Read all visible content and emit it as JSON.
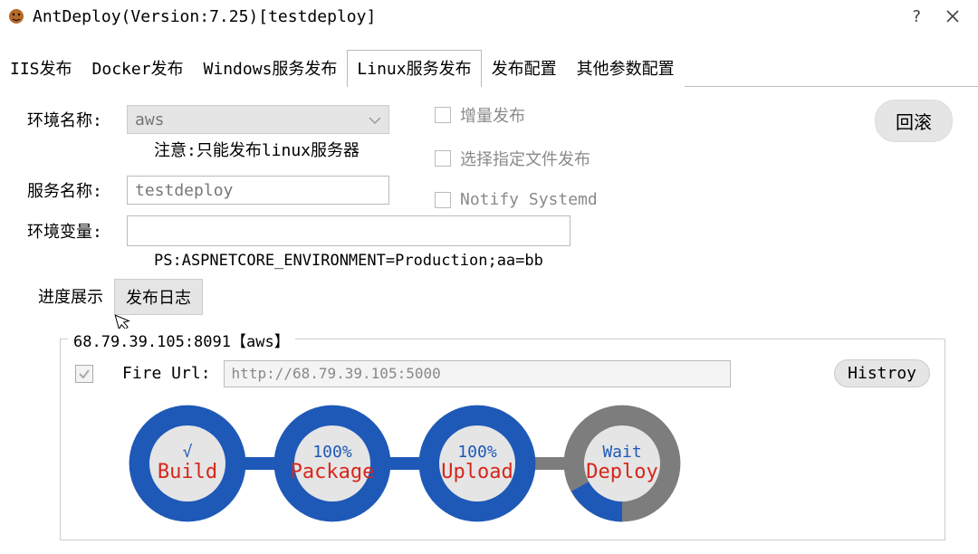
{
  "window": {
    "title": "AntDeploy(Version:7.25)[testdeploy]"
  },
  "tabs": [
    "IIS发布",
    "Docker发布",
    "Windows服务发布",
    "Linux服务发布",
    "发布配置",
    "其他参数配置"
  ],
  "active_tab_index": 3,
  "rollback": {
    "label": "回滚"
  },
  "form": {
    "env_label": "环境名称:",
    "env_value": "aws",
    "env_note": "注意:只能发布linux服务器",
    "service_label": "服务名称:",
    "service_value": "testdeploy",
    "envvar_label": "环境变量:",
    "envvar_value": "",
    "ps_note": "PS:ASPNETCORE_ENVIRONMENT=Production;aa=bb"
  },
  "checks": {
    "incremental": "增量发布",
    "select_files": "选择指定文件发布",
    "notify_systemd": "Notify Systemd"
  },
  "sub_tabs": {
    "progress": "进度展示",
    "log": "发布日志",
    "active_index": 0
  },
  "progress": {
    "host_legend": "68.79.39.105:8091【aws】",
    "fire_label": "Fire Url:",
    "fire_url": "http://68.79.39.105:5000",
    "history_label": "Histroy",
    "stages": [
      {
        "top": "√",
        "bottom": "Build",
        "mode": "done"
      },
      {
        "top": "100%",
        "bottom": "Package",
        "mode": "done"
      },
      {
        "top": "100%",
        "bottom": "Upload",
        "mode": "done"
      },
      {
        "top": "Wait",
        "bottom": "Deploy",
        "mode": "wait"
      }
    ]
  },
  "colors": {
    "ring_blue": "#1e59b8",
    "ring_grey": "#7d7d7d",
    "center": "#e5e5e5"
  }
}
